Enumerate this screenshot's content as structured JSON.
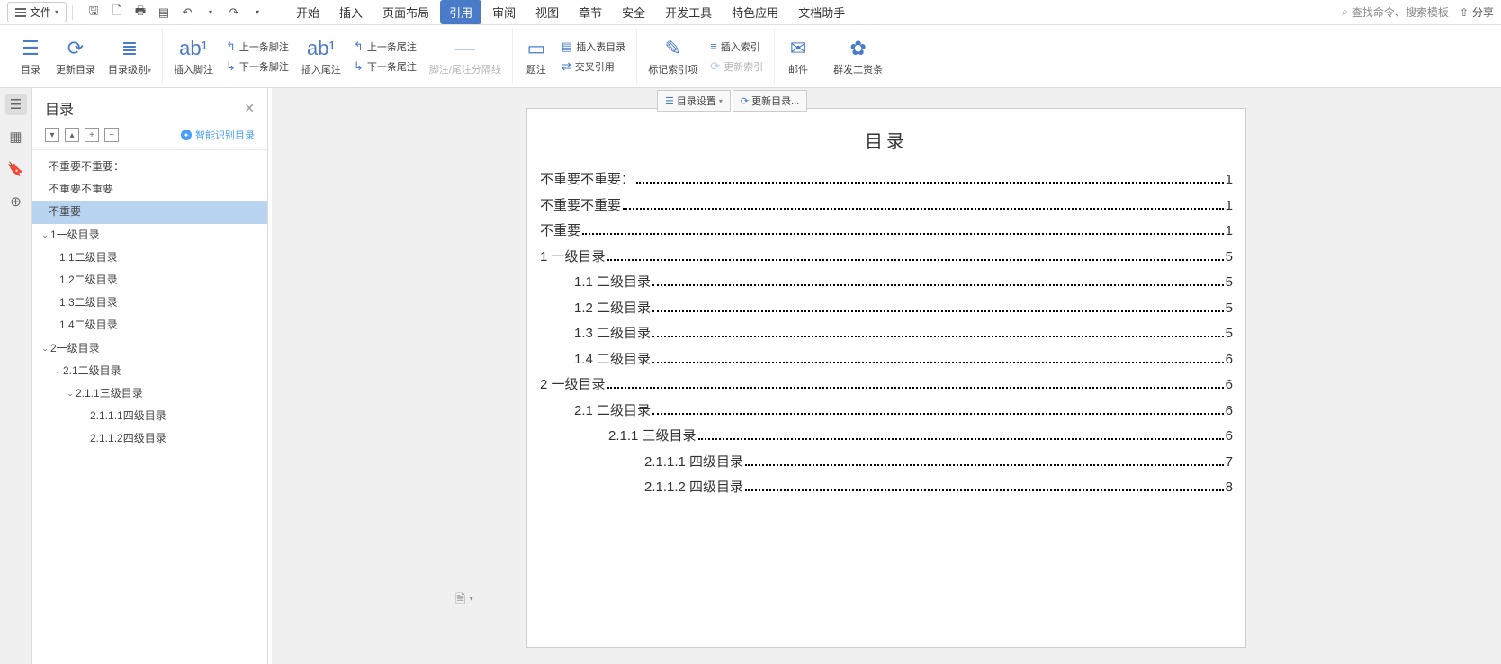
{
  "menubar": {
    "file_label": "文件",
    "tabs": [
      "开始",
      "插入",
      "页面布局",
      "引用",
      "审阅",
      "视图",
      "章节",
      "安全",
      "开发工具",
      "特色应用",
      "文档助手"
    ],
    "active_tab_index": 3,
    "search_placeholder": "查找命令、搜索模板",
    "share_label": "分享"
  },
  "ribbon": {
    "toc": "目录",
    "update_toc": "更新目录",
    "toc_level": "目录级别",
    "insert_footnote": "插入脚注",
    "prev_footnote": "上一条脚注",
    "next_footnote": "下一条脚注",
    "insert_endnote": "插入尾注",
    "prev_endnote": "上一条尾注",
    "next_endnote": "下一条尾注",
    "footnote_sep": "脚注/尾注分隔线",
    "caption": "题注",
    "insert_fig_toc": "插入表目录",
    "cross_ref": "交叉引用",
    "mark_index": "标记索引项",
    "insert_index": "插入索引",
    "update_index": "更新索引",
    "mail": "邮件",
    "payroll": "群发工资条"
  },
  "sidebar": {
    "title": "目录",
    "smart_label": "智能识别目录",
    "items": [
      {
        "text": "不重要不重要：",
        "indent": 0,
        "chevron": false,
        "selected": false
      },
      {
        "text": "不重要不重要",
        "indent": 0,
        "chevron": false,
        "selected": false
      },
      {
        "text": "不重要",
        "indent": 0,
        "chevron": false,
        "selected": true
      },
      {
        "text": "1一级目录",
        "indent": 1,
        "chevron": true,
        "selected": false
      },
      {
        "text": "1.1二级目录",
        "indent": 2,
        "chevron": false,
        "selected": false
      },
      {
        "text": "1.2二级目录",
        "indent": 2,
        "chevron": false,
        "selected": false
      },
      {
        "text": "1.3二级目录",
        "indent": 2,
        "chevron": false,
        "selected": false
      },
      {
        "text": "1.4二级目录",
        "indent": 2,
        "chevron": false,
        "selected": false
      },
      {
        "text": "2一级目录",
        "indent": 1,
        "chevron": true,
        "selected": false
      },
      {
        "text": "2.1二级目录",
        "indent": 3,
        "chevron": true,
        "selected": false
      },
      {
        "text": "2.1.1三级目录",
        "indent": 4,
        "chevron": true,
        "selected": false
      },
      {
        "text": "2.1.1.1四级目录",
        "indent": 5,
        "chevron": false,
        "selected": false
      },
      {
        "text": "2.1.1.2四级目录",
        "indent": 5,
        "chevron": false,
        "selected": false
      }
    ]
  },
  "floatbar": {
    "toc_settings": "目录设置",
    "update_toc": "更新目录..."
  },
  "document": {
    "toc_title": "目录",
    "entries": [
      {
        "text": "不重要不重要：",
        "page": "1",
        "level": 0
      },
      {
        "text": "不重要不重要",
        "page": "1",
        "level": 0
      },
      {
        "text": "不重要",
        "page": "1",
        "level": 0
      },
      {
        "text": "1 一级目录",
        "page": "5",
        "level": 0
      },
      {
        "text": "1.1 二级目录",
        "page": "5",
        "level": 1
      },
      {
        "text": "1.2 二级目录",
        "page": "5",
        "level": 1
      },
      {
        "text": "1.3 二级目录",
        "page": "5",
        "level": 1
      },
      {
        "text": "1.4 二级目录",
        "page": "6",
        "level": 1
      },
      {
        "text": "2 一级目录",
        "page": "6",
        "level": 0
      },
      {
        "text": "2.1 二级目录",
        "page": "6",
        "level": 1
      },
      {
        "text": "2.1.1 三级目录",
        "page": "6",
        "level": 2
      },
      {
        "text": "2.1.1.1 四级目录",
        "page": "7",
        "level": 3
      },
      {
        "text": "2.1.1.2 四级目录",
        "page": "8",
        "level": 3
      }
    ]
  }
}
